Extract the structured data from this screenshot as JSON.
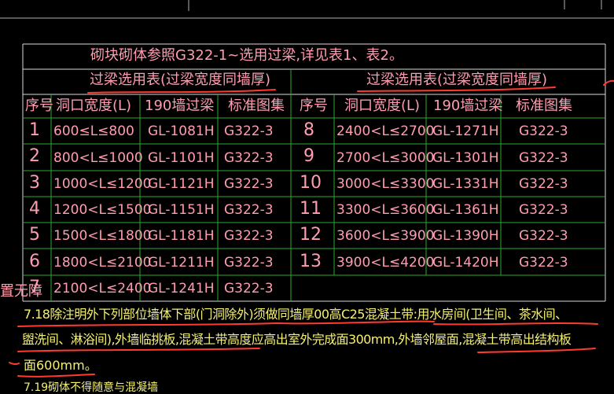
{
  "header": {
    "note": "砌块砌体参照G322-1~选用过梁,详见表1、表2。",
    "left_title": "过梁选用表(过梁宽度同墙厚)",
    "right_title": "过梁选用表(过梁宽度同墙厚)"
  },
  "columns": [
    "序号",
    "洞口宽度(L)",
    "190墙过梁",
    "标准图集"
  ],
  "left_rows": [
    {
      "no": "1",
      "range": "600≤L≤800",
      "beam": "GL-1081H",
      "atlas": "G322-3"
    },
    {
      "no": "2",
      "range": "800<L≤1000",
      "beam": "GL-1101H",
      "atlas": "G322-3"
    },
    {
      "no": "3",
      "range": "1000<L≤1200",
      "beam": "GL-1121H",
      "atlas": "G322-3"
    },
    {
      "no": "4",
      "range": "1200<L≤1500",
      "beam": "GL-1151H",
      "atlas": "G322-3"
    },
    {
      "no": "5",
      "range": "1500<L≤1800",
      "beam": "GL-1181H",
      "atlas": "G322-3"
    },
    {
      "no": "6",
      "range": "1800<L≤2100",
      "beam": "GL-1211H",
      "atlas": "G322-3"
    },
    {
      "no": "7",
      "range": "2100<L≤2400",
      "beam": "GL-1241H",
      "atlas": "G322-3"
    }
  ],
  "right_rows": [
    {
      "no": "8",
      "range": "2400<L≤2700",
      "beam": "GL-1271H",
      "atlas": "G322-3"
    },
    {
      "no": "9",
      "range": "2700<L≤3000",
      "beam": "GL-1301H",
      "atlas": "G322-3"
    },
    {
      "no": "10",
      "range": "3000<L≤3300",
      "beam": "GL-1331H",
      "atlas": "G322-3"
    },
    {
      "no": "11",
      "range": "3300<L≤3600",
      "beam": "GL-1361H",
      "atlas": "G322-3"
    },
    {
      "no": "12",
      "range": "3600<L≤3900",
      "beam": "GL-1390H",
      "atlas": "G322-3"
    },
    {
      "no": "13",
      "range": "3900<L≤4200",
      "beam": "GL-1420H",
      "atlas": "G322-3"
    }
  ],
  "side_label": "置无障",
  "notes": {
    "line1": "7.18除注明外下列部位墙体下部(门洞除外)须做同墙厚00高C25混凝土带:用水房间(卫生间、茶水间、",
    "line2": "盥洗间、淋浴间),外墙临挑板,混凝土带高度应高出室外完成面300mm,外墙邻屋面,混凝土带高出结构板",
    "line3": "面600mm。",
    "line4": "7.19砌体不得随意与混凝墙"
  },
  "colors": {
    "background": "#000000",
    "text": "#ff9db0",
    "grid": "#2ea82e",
    "notes_text": "#f5f070",
    "markup": "#ff3b30"
  }
}
